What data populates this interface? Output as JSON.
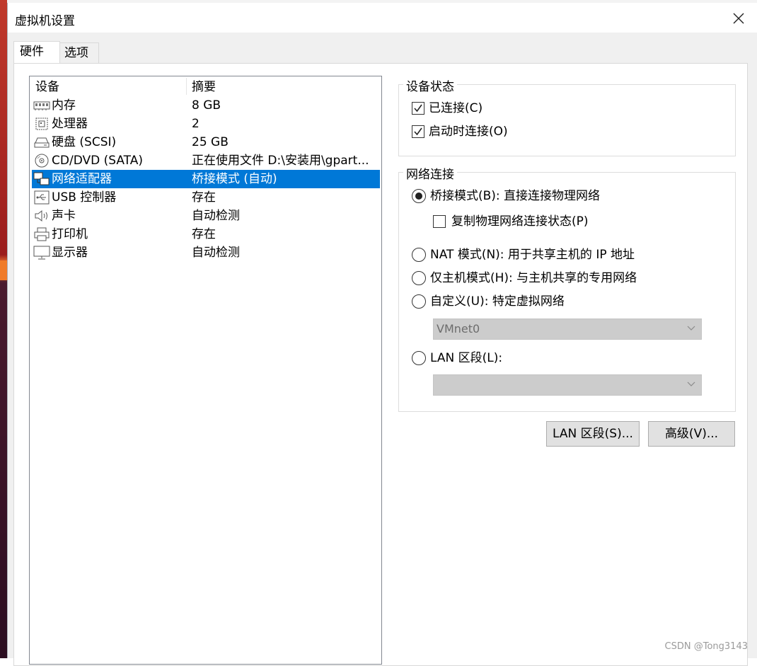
{
  "window": {
    "title": "虚拟机设置"
  },
  "tabs": [
    {
      "label": "硬件",
      "active": true
    },
    {
      "label": "选项",
      "active": false
    }
  ],
  "device_list": {
    "headers": {
      "device": "设备",
      "summary": "摘要"
    },
    "rows": [
      {
        "icon": "memory-icon",
        "name": "内存",
        "summary": "8 GB",
        "selected": false
      },
      {
        "icon": "processor-icon",
        "name": "处理器",
        "summary": "2",
        "selected": false
      },
      {
        "icon": "harddisk-icon",
        "name": "硬盘 (SCSI)",
        "summary": "25 GB",
        "selected": false
      },
      {
        "icon": "cd-dvd-icon",
        "name": "CD/DVD (SATA)",
        "summary": "正在使用文件 D:\\安装用\\gpart...",
        "selected": false
      },
      {
        "icon": "network-adapter-icon",
        "name": "网络适配器",
        "summary": "桥接模式 (自动)",
        "selected": true
      },
      {
        "icon": "usb-icon",
        "name": "USB 控制器",
        "summary": "存在",
        "selected": false
      },
      {
        "icon": "sound-card-icon",
        "name": "声卡",
        "summary": "自动检测",
        "selected": false
      },
      {
        "icon": "printer-icon",
        "name": "打印机",
        "summary": "存在",
        "selected": false
      },
      {
        "icon": "display-icon",
        "name": "显示器",
        "summary": "自动检测",
        "selected": false
      }
    ]
  },
  "device_status": {
    "title": "设备状态",
    "connected": {
      "label": "已连接(C)",
      "checked": true
    },
    "connect_at_power_on": {
      "label": "启动时连接(O)",
      "checked": true
    }
  },
  "network_connection": {
    "title": "网络连接",
    "bridged": {
      "label": "桥接模式(B): 直接连接物理网络",
      "selected": true
    },
    "replicate_state": {
      "label": "复制物理网络连接状态(P)",
      "checked": false
    },
    "nat": {
      "label": "NAT 模式(N): 用于共享主机的 IP 地址",
      "selected": false
    },
    "host_only": {
      "label": "仅主机模式(H): 与主机共享的专用网络",
      "selected": false
    },
    "custom": {
      "label": "自定义(U): 特定虚拟网络",
      "selected": false
    },
    "custom_select": {
      "value": "VMnet0"
    },
    "lan_segment": {
      "label": "LAN 区段(L):",
      "selected": false
    },
    "lan_select": {
      "value": ""
    }
  },
  "buttons": {
    "lan_segments": "LAN 区段(S)...",
    "advanced": "高级(V)..."
  },
  "watermark": "CSDN @Tong3143",
  "colors": {
    "selection": "#0078d7",
    "disabled_combo": "#cccccc"
  }
}
